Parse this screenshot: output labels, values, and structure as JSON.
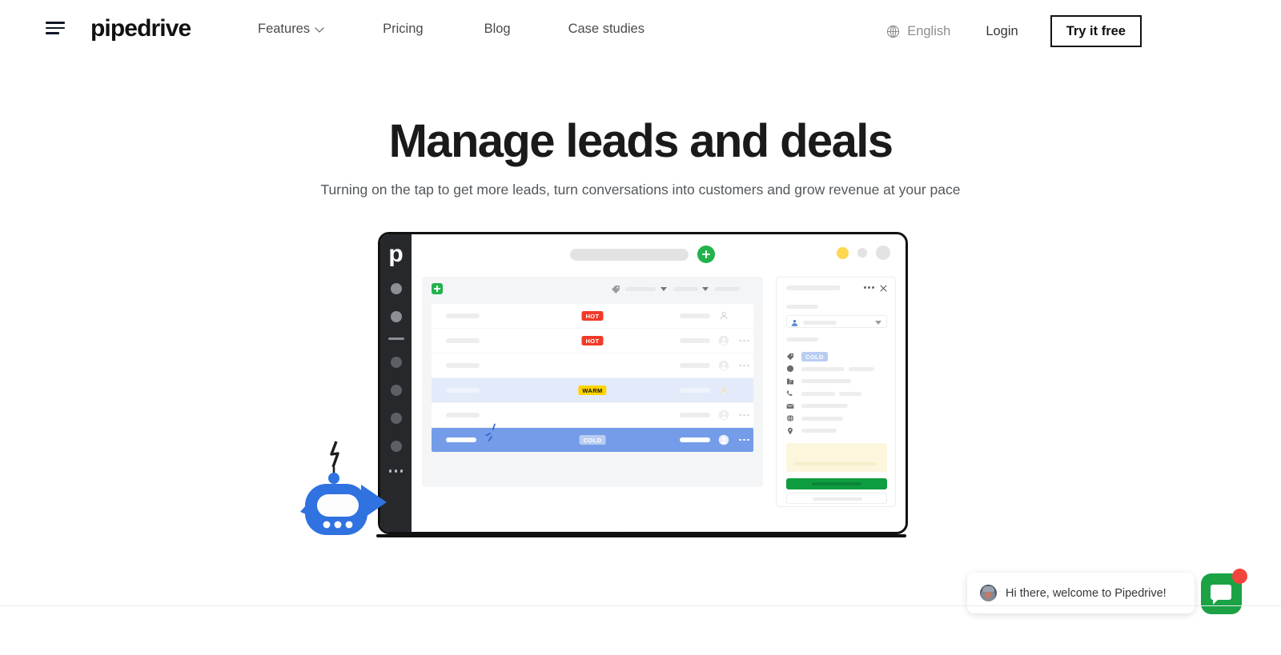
{
  "header": {
    "menu_icon": "hamburger-icon",
    "brand": "pipedrive",
    "nav": [
      {
        "label": "Features",
        "has_dropdown": true
      },
      {
        "label": "Pricing",
        "has_dropdown": false
      },
      {
        "label": "Blog",
        "has_dropdown": false
      },
      {
        "label": "Case studies",
        "has_dropdown": false
      }
    ],
    "language": {
      "label": "English",
      "icon": "globe-icon"
    },
    "login_label": "Login",
    "cta_label": "Try it free"
  },
  "hero": {
    "title": "Manage leads and deals",
    "subtitle": "Turning on the tap to get more leads, turn conversations into customers and grow revenue at your pace"
  },
  "mockup": {
    "sidebar": {
      "logo": "p"
    },
    "topbar": {
      "search_placeholder": "",
      "add_icon": "plus-circle-icon",
      "window_dots": [
        "yellow",
        "gray",
        "gray"
      ]
    },
    "table": {
      "filter_icons": [
        "plus-square-icon",
        "tag-icon",
        "caret-down-icon",
        "caret-down-icon"
      ],
      "rows": [
        {
          "badge": "HOT",
          "badge_type": "hot",
          "state": "default",
          "has_more": false
        },
        {
          "badge": "HOT",
          "badge_type": "hot",
          "state": "default",
          "has_more": true
        },
        {
          "badge": "",
          "badge_type": "",
          "state": "default",
          "has_more": true
        },
        {
          "badge": "WARM",
          "badge_type": "warm",
          "state": "hover",
          "has_more": false
        },
        {
          "badge": "",
          "badge_type": "",
          "state": "default",
          "has_more": true
        },
        {
          "badge": "COLD",
          "badge_type": "cold",
          "state": "selected",
          "has_more": true
        }
      ]
    },
    "detail": {
      "more_icon": "ellipsis-icon",
      "close_icon": "close-icon",
      "owner_icon": "person-icon",
      "badge": "COLD",
      "fields": [
        {
          "icon": "tag-icon"
        },
        {
          "icon": "contact-icon"
        },
        {
          "icon": "organization-icon"
        },
        {
          "icon": "phone-icon"
        },
        {
          "icon": "email-icon"
        },
        {
          "icon": "globe-icon"
        },
        {
          "icon": "location-pin-icon"
        }
      ],
      "primary_button": "",
      "secondary_button": ""
    },
    "mascot": "robot-icon"
  },
  "chat": {
    "message": "Hi there, welcome to Pipedrive!",
    "avatar": "agent-avatar",
    "launcher_icon": "chat-bubble-icon",
    "unread_badge": ""
  },
  "colors": {
    "brand_dark": "#111111",
    "green": "#22b24c",
    "hot": "#f33a28",
    "warm": "#ffd400",
    "cold": "#b9cdf3",
    "selected_row": "#749ce8",
    "chat_green": "#1aa245",
    "badge_red": "#f4453c"
  }
}
